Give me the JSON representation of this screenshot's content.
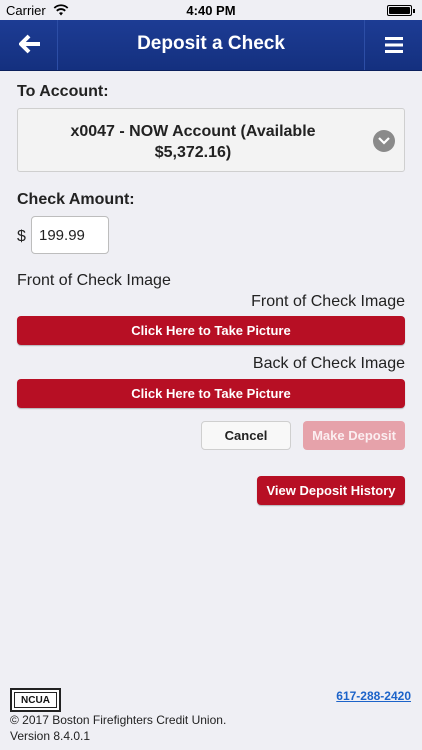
{
  "status_bar": {
    "carrier": "Carrier",
    "time": "4:40 PM"
  },
  "nav": {
    "title": "Deposit a Check",
    "back_icon": "back-arrow-icon",
    "menu_icon": "hamburger-menu-icon",
    "background_color": "#1d3c94"
  },
  "form": {
    "to_account_label": "To Account:",
    "account_line1": "x0047 - NOW Account (Available",
    "account_line2": "$5,372.16)",
    "check_amount_label": "Check Amount:",
    "currency_symbol": "$",
    "amount_value": "199.99",
    "front_image_heading": "Front of Check Image",
    "front_image_label": "Front of Check Image",
    "front_picture_button": "Click Here to Take Picture",
    "back_image_label": "Back of Check Image",
    "back_picture_button": "Click Here to Take Picture",
    "cancel_button": "Cancel",
    "make_deposit_button": "Make Deposit",
    "view_history_button": "View Deposit History"
  },
  "footer": {
    "ncua_logo_text": "NCUA",
    "phone": "617-288-2420",
    "copyright": "© 2017 Boston Firefighters Credit Union.",
    "version": "Version 8.4.0.1"
  },
  "colors": {
    "accent_red": "#b70f24",
    "disabled_red": "#e6a2aa",
    "link_blue": "#1c63c9"
  }
}
